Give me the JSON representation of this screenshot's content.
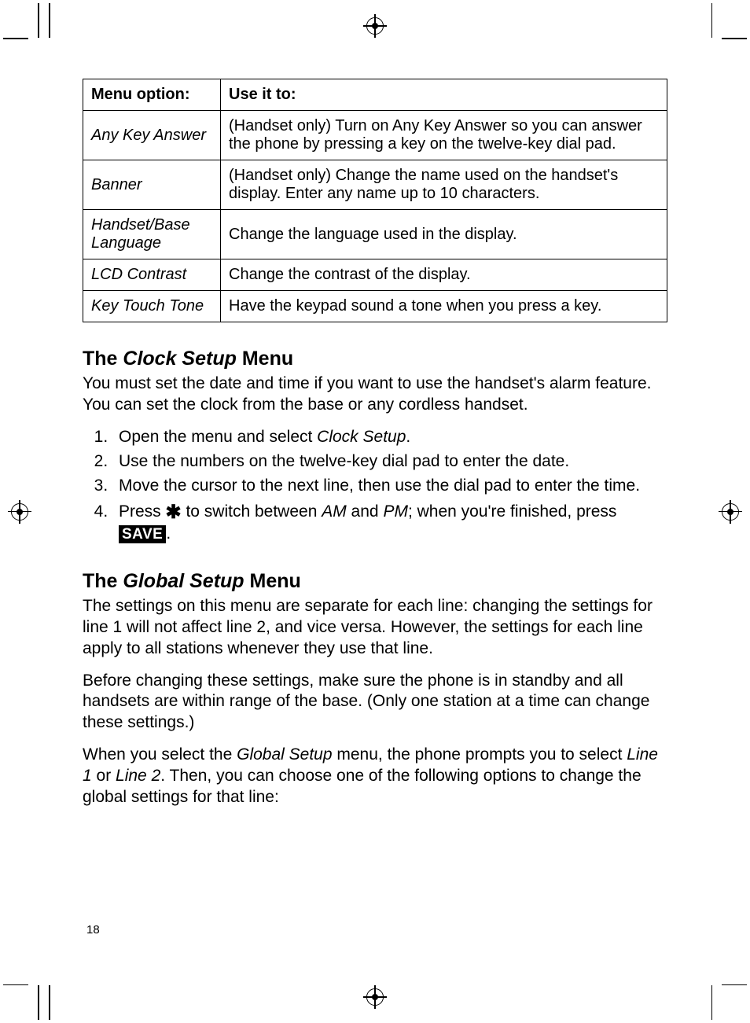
{
  "table": {
    "headers": [
      "Menu option:",
      "Use it to:"
    ],
    "rows": [
      {
        "menu": "Any Key Answer",
        "desc": "(Handset only) Turn on Any Key Answer so you can answer the phone by pressing a key on the twelve-key dial pad."
      },
      {
        "menu": "Banner",
        "desc": "(Handset only) Change the name used on the handset's display. Enter any name up to 10 characters."
      },
      {
        "menu": "Handset/Base Language",
        "desc": "Change the language used in the display."
      },
      {
        "menu": "LCD Contrast",
        "desc": "Change the contrast of the display."
      },
      {
        "menu": "Key Touch Tone",
        "desc": "Have the keypad sound a tone when you press a key."
      }
    ]
  },
  "section_clock": {
    "heading_pre": "The ",
    "heading_ital": "Clock Setup",
    "heading_post": " Menu",
    "intro": "You must set the date and time if you want to use the handset's alarm feature. You can set the clock from the base or any cordless handset.",
    "steps": {
      "s1_a": "Open the menu and select ",
      "s1_ital": "Clock Setup",
      "s1_b": ".",
      "s2": "Use the numbers on the twelve-key dial pad to enter the date.",
      "s3": "Move the cursor to the next line, then use the dial pad to enter the time.",
      "s4_a": "Press ",
      "s4_star": "✱",
      "s4_b": " to switch between ",
      "s4_am": "AM",
      "s4_c": " and ",
      "s4_pm": "PM",
      "s4_d": "; when you're finished, press ",
      "s4_save": "SAVE",
      "s4_e": "."
    }
  },
  "section_global": {
    "heading_pre": "The ",
    "heading_ital": "Global Setup",
    "heading_post": " Menu",
    "p1": "The settings on this menu are separate for each line: changing the settings for line 1 will not affect line 2, and vice versa. However, the settings for each line apply to all stations whenever they use that line.",
    "p2": "Before changing these settings, make sure the phone is in standby and all handsets are within range of the base. (Only one station at a time can change these settings.)",
    "p3_a": "When you select the ",
    "p3_ital1": "Global Setup",
    "p3_b": " menu, the phone prompts you to select ",
    "p3_ital2": "Line 1",
    "p3_c": " or ",
    "p3_ital3": "Line 2",
    "p3_d": ". Then, you can choose one of the following options to change the global settings for that line:"
  },
  "page_number": "18"
}
